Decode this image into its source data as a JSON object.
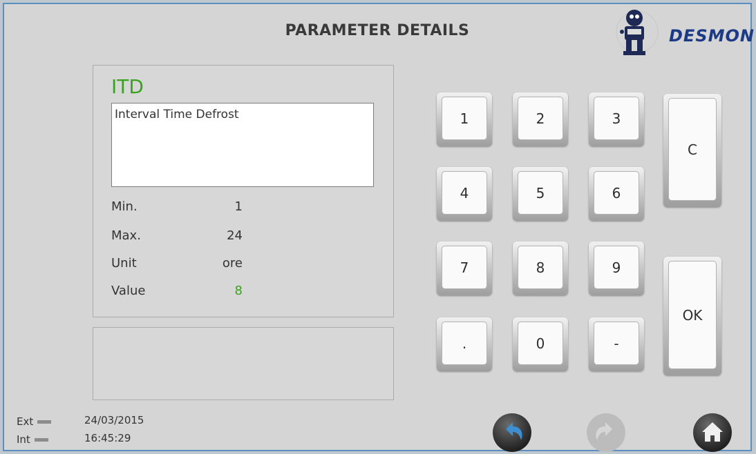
{
  "header": {
    "title": "PARAMETER DETAILS",
    "brand": "DESMON"
  },
  "parameter": {
    "code": "ITD",
    "description": "Interval Time Defrost",
    "min_label": "Min.",
    "min_value": "1",
    "max_label": "Max.",
    "max_value": "24",
    "unit_label": "Unit",
    "unit_value": "ore",
    "value_label": "Value",
    "value": "8"
  },
  "keypad": {
    "k1": "1",
    "k2": "2",
    "k3": "3",
    "k4": "4",
    "k5": "5",
    "k6": "6",
    "k7": "7",
    "k8": "8",
    "k9": "9",
    "kdot": ".",
    "k0": "0",
    "kminus": "-",
    "clear": "C",
    "ok": "OK"
  },
  "status": {
    "ext_label": "Ext",
    "int_label": "Int",
    "date": "24/03/2015",
    "time": "16:45:29"
  },
  "nav": {
    "back_icon": "undo-arrow-icon",
    "forward_icon": "redo-arrow-icon",
    "home_icon": "home-icon"
  },
  "colors": {
    "accent_green": "#3aa31d",
    "brand_blue": "#1c3a85",
    "nav_blue": "#3d8fd4"
  }
}
